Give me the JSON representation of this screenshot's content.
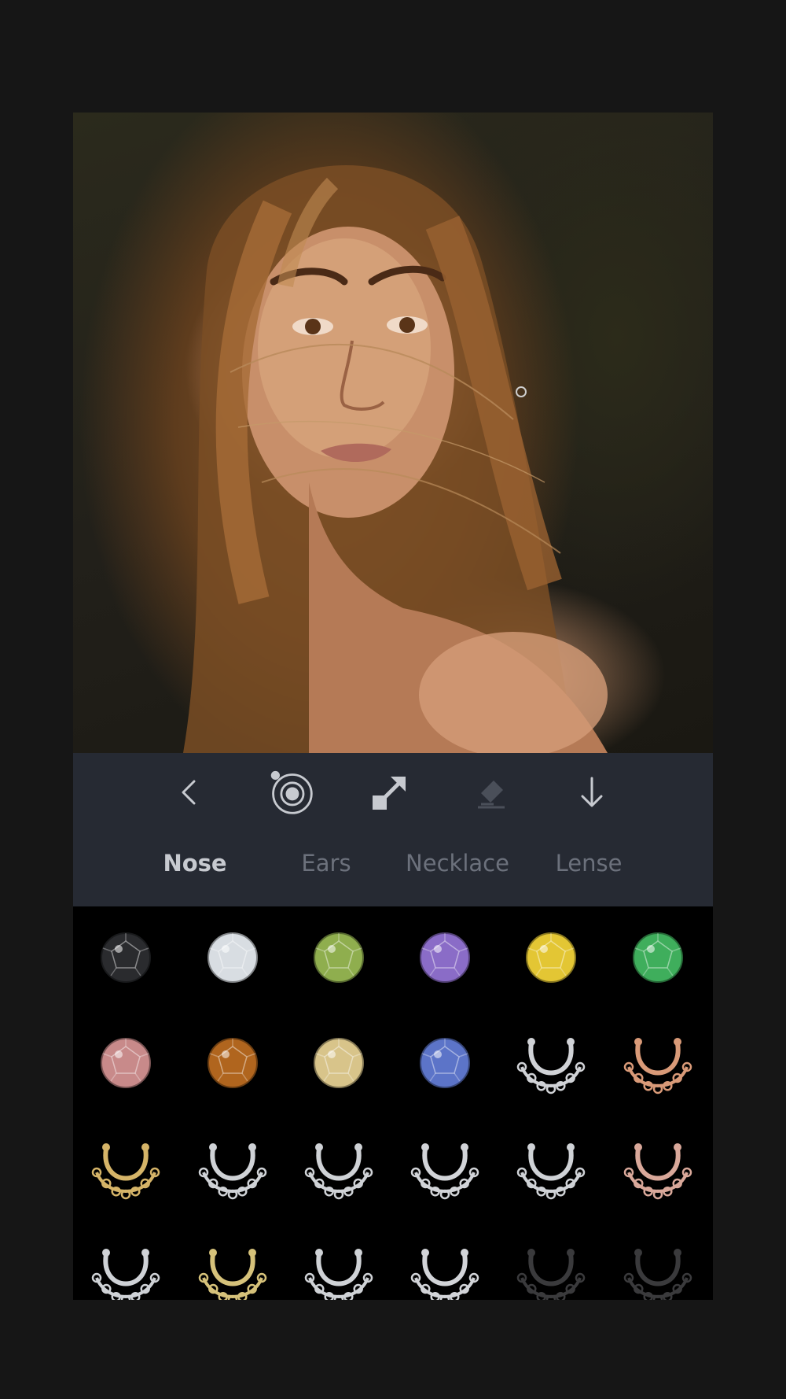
{
  "tabs": [
    {
      "label": "Nose",
      "active": true
    },
    {
      "label": "Ears",
      "active": false
    },
    {
      "label": "Necklace",
      "active": false
    },
    {
      "label": "Lense",
      "active": false
    }
  ],
  "toolbar": {
    "icons": [
      "back-icon",
      "target-icon",
      "resize-icon",
      "eraser-icon",
      "download-icon"
    ],
    "disabled": [
      "eraser-icon"
    ]
  },
  "jewelry": [
    {
      "type": "gem",
      "color": "#2a2b2e"
    },
    {
      "type": "gem",
      "color": "#d8dde2"
    },
    {
      "type": "gem",
      "color": "#8fae4e"
    },
    {
      "type": "gem",
      "color": "#8a6cc7"
    },
    {
      "type": "gem",
      "color": "#e3c634"
    },
    {
      "type": "gem",
      "color": "#3fae5c"
    },
    {
      "type": "gem",
      "color": "#c88a8a"
    },
    {
      "type": "gem",
      "color": "#b0651e"
    },
    {
      "type": "gem",
      "color": "#d8c48a"
    },
    {
      "type": "gem",
      "color": "#5c74c8"
    },
    {
      "type": "septum",
      "color": "#d0d2d6"
    },
    {
      "type": "septum",
      "color": "#d99a78"
    },
    {
      "type": "septum",
      "color": "#d5b468"
    },
    {
      "type": "septum",
      "color": "#cfd2d6"
    },
    {
      "type": "septum",
      "color": "#cfd2d6"
    },
    {
      "type": "septum",
      "color": "#d2d4d8"
    },
    {
      "type": "septum",
      "color": "#cfd2d6"
    },
    {
      "type": "septum",
      "color": "#d9a89a"
    },
    {
      "type": "septum",
      "color": "#cfd2d6"
    },
    {
      "type": "septum",
      "color": "#d6c27a"
    },
    {
      "type": "septum",
      "color": "#cfd2d6"
    },
    {
      "type": "septum",
      "color": "#d2d4d8"
    },
    {
      "type": "septum",
      "color": "#3a3a3c"
    },
    {
      "type": "septum",
      "color": "#3a3a3c"
    }
  ]
}
